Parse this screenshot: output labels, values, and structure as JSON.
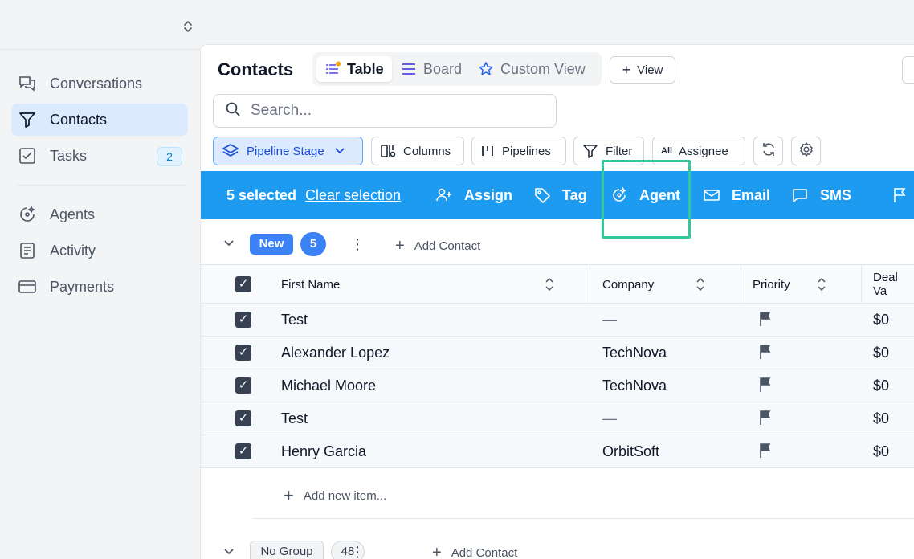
{
  "sidebar": {
    "items": [
      {
        "label": "Conversations",
        "icon": "chat-bubbles-icon"
      },
      {
        "label": "Contacts",
        "icon": "funnel-icon"
      },
      {
        "label": "Tasks",
        "icon": "checkbox-icon",
        "badge": "2"
      },
      {
        "label": "Agents",
        "icon": "sparkle-agent-icon"
      },
      {
        "label": "Activity",
        "icon": "document-list-icon"
      },
      {
        "label": "Payments",
        "icon": "credit-card-icon"
      }
    ]
  },
  "header": {
    "title": "Contacts",
    "tabs": [
      {
        "label": "Table",
        "icon": "list-star-icon",
        "active": true
      },
      {
        "label": "Board",
        "icon": "board-lines-icon"
      },
      {
        "label": "Custom View",
        "icon": "star-icon"
      }
    ],
    "add_view_label": "View"
  },
  "search": {
    "placeholder": "Search..."
  },
  "filters": {
    "pipeline_stage": "Pipeline Stage",
    "columns": "Columns",
    "pipelines": "Pipelines",
    "filter": "Filter",
    "assignee_prefix": "All",
    "assignee": "Assignee"
  },
  "action_bar": {
    "selected": "5 selected",
    "clear": "Clear selection",
    "assign": "Assign",
    "tag": "Tag",
    "agent": "Agent",
    "email": "Email",
    "sms": "SMS"
  },
  "groups": [
    {
      "name": "New",
      "count": "5",
      "add_contact": "Add Contact"
    },
    {
      "name": "No Group",
      "count": "48",
      "add_contact": "Add Contact"
    }
  ],
  "table": {
    "columns": [
      "First Name",
      "Company",
      "Priority",
      "Deal Va"
    ],
    "rows": [
      {
        "first_name": "Test",
        "company": "—",
        "deal": "$0"
      },
      {
        "first_name": "Alexander Lopez",
        "company": "TechNova",
        "deal": "$0"
      },
      {
        "first_name": "Michael Moore",
        "company": "TechNova",
        "deal": "$0"
      },
      {
        "first_name": "Test",
        "company": "—",
        "deal": "$0"
      },
      {
        "first_name": "Henry Garcia",
        "company": "OrbitSoft",
        "deal": "$0"
      }
    ],
    "add_new_item": "Add new item..."
  },
  "colors": {
    "accent": "#1d9bf0",
    "highlight": "#34c79b",
    "brand_blue": "#3b82f6"
  }
}
